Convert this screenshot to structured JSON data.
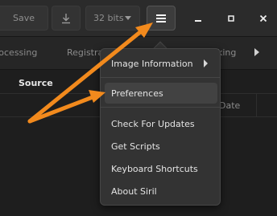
{
  "header": {
    "save_label": "Save",
    "bits_label": "32 bits",
    "icons": [
      "export-icon",
      "dropdown-caret-icon",
      "hamburger-menu-icon",
      "minimize-icon",
      "maximize-icon",
      "close-icon"
    ]
  },
  "tabs": [
    {
      "label": "rocessing"
    },
    {
      "label": "Registra"
    },
    {
      "label": "king"
    }
  ],
  "content": {
    "source_label": "Source",
    "date_label": "Date"
  },
  "menu": {
    "items": [
      {
        "label": "Image Information"
      },
      {
        "label": "Preferences"
      },
      {
        "label": "Check For Updates"
      },
      {
        "label": "Get Scripts"
      },
      {
        "label": "Keyboard Shortcuts"
      },
      {
        "label": "About Siril"
      }
    ]
  },
  "colors": {
    "arrow": "#f28a1d",
    "menu_bg": "#333333",
    "highlight": "#424242"
  }
}
